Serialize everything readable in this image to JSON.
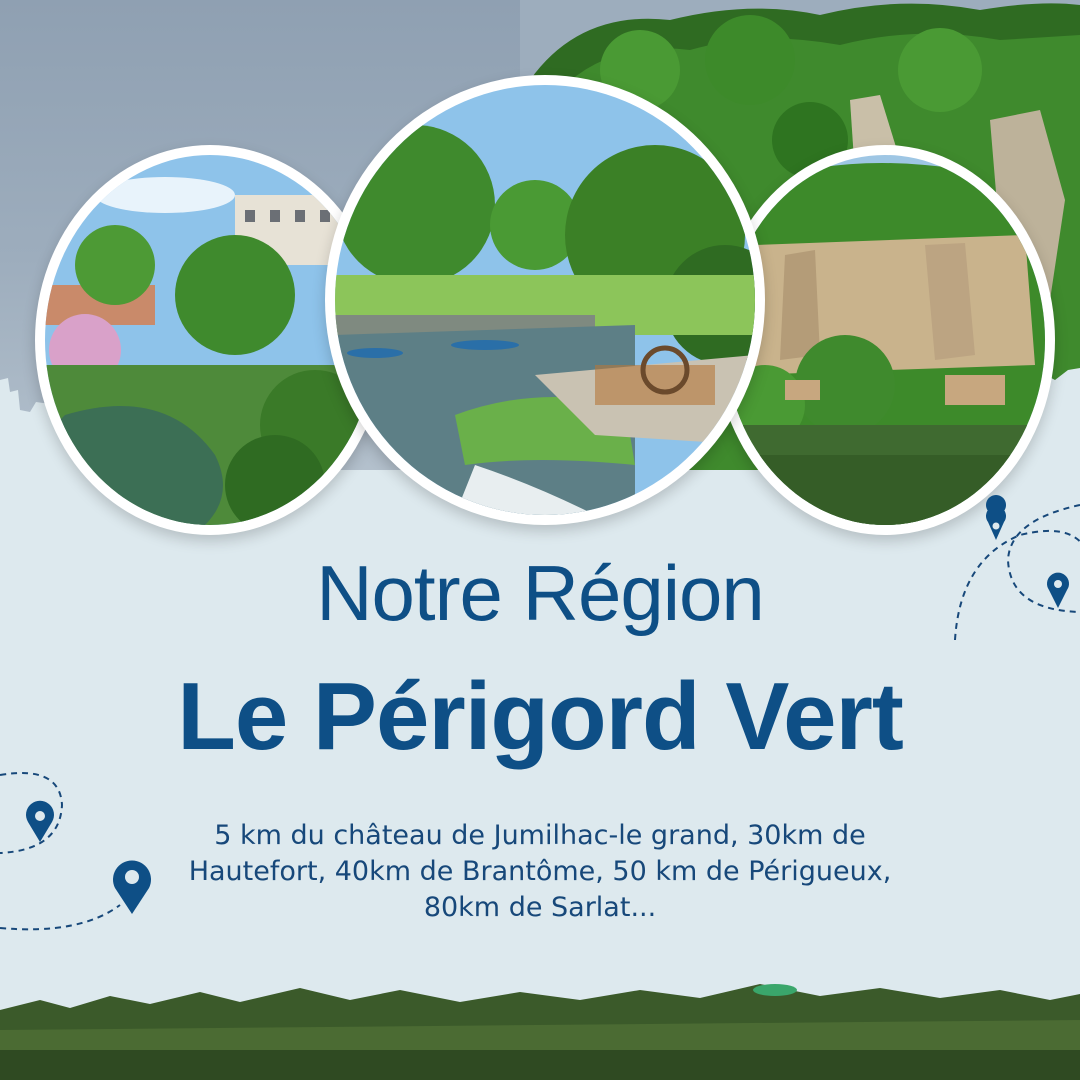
{
  "heading": {
    "line1": "Notre Région",
    "line2": "Le Périgord Vert"
  },
  "description": "5 km du château de Jumilhac-le grand, 30km de Hautefort, 40km de Brantôme, 50 km de Périgueux, 80km de Sarlat...",
  "colors": {
    "heading": "#0e4f86",
    "text": "#17487a",
    "panel": "#dde9ee",
    "sky": "#9dadbd"
  },
  "icons": [
    "map-pin-icon",
    "map-pin-icon",
    "map-pin-icon",
    "map-pin-icon"
  ]
}
